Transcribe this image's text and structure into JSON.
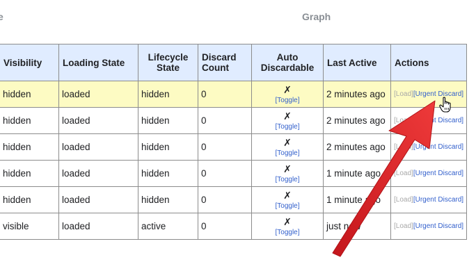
{
  "header": {
    "left_partial": "e",
    "graph": "Graph"
  },
  "table": {
    "columns": {
      "visibility": "Visibility",
      "loading_state": "Loading State",
      "lifecycle_line1": "Lifecycle",
      "lifecycle_line2": "State",
      "discard_line1": "Discard",
      "discard_line2": "Count",
      "auto_line1": "Auto",
      "auto_line2": "Discardable",
      "last_active": "Last Active",
      "actions": "Actions"
    },
    "rows": [
      {
        "visibility": "hidden",
        "loading_state": "loaded",
        "lifecycle_state": "hidden",
        "discard_count": "0",
        "auto_discardable": "✗",
        "toggle": "[Toggle]",
        "last_active": "2 minutes ago",
        "load": "[Load]",
        "urgent_discard": "[Urgent Discard]"
      },
      {
        "visibility": "hidden",
        "loading_state": "loaded",
        "lifecycle_state": "hidden",
        "discard_count": "0",
        "auto_discardable": "✗",
        "toggle": "[Toggle]",
        "last_active": "2 minutes ago",
        "load": "[Load]",
        "urgent_discard": "[Urgent Discard]"
      },
      {
        "visibility": "hidden",
        "loading_state": "loaded",
        "lifecycle_state": "hidden",
        "discard_count": "0",
        "auto_discardable": "✗",
        "toggle": "[Toggle]",
        "last_active": "2 minutes ago",
        "load": "[Load]",
        "urgent_discard": "[Urgent Discard]"
      },
      {
        "visibility": "hidden",
        "loading_state": "loaded",
        "lifecycle_state": "hidden",
        "discard_count": "0",
        "auto_discardable": "✗",
        "toggle": "[Toggle]",
        "last_active": "1 minute ago",
        "load": "[Load]",
        "urgent_discard": "[Urgent Discard]"
      },
      {
        "visibility": "hidden",
        "loading_state": "loaded",
        "lifecycle_state": "hidden",
        "discard_count": "0",
        "auto_discardable": "✗",
        "toggle": "[Toggle]",
        "last_active": "1 minute ago",
        "load": "[Load]",
        "urgent_discard": "[Urgent Discard]"
      },
      {
        "visibility": "visible",
        "loading_state": "loaded",
        "lifecycle_state": "active",
        "discard_count": "0",
        "auto_discardable": "✗",
        "toggle": "[Toggle]",
        "last_active": "just now",
        "load": "[Load]",
        "urgent_discard": "[Urgent Discard]"
      }
    ]
  },
  "colors": {
    "header_bg": "#e0ecff",
    "highlight_row": "#fdfbc3",
    "link": "#3360cc",
    "disabled_link": "#a8a8a8",
    "arrow": "#e0262b"
  },
  "icons": {
    "arrow": "red-annotation-arrow",
    "cursor": "hand-pointer-icon"
  }
}
